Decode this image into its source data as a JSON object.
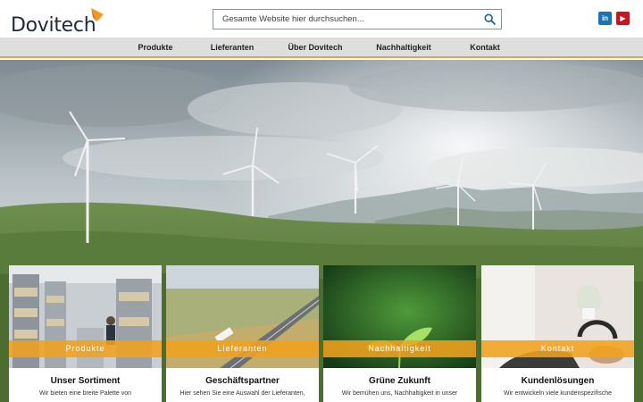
{
  "brand": {
    "name": "Dovitech",
    "accent": "#f0a23a"
  },
  "search": {
    "placeholder": "Gesamte Website hier durchsuchen..."
  },
  "social": {
    "linkedin": "in",
    "youtube": "▶"
  },
  "nav": {
    "items": [
      {
        "label": "Produkte"
      },
      {
        "label": "Lieferanten"
      },
      {
        "label": "Über Dovitech"
      },
      {
        "label": "Nachhaltigkeit"
      },
      {
        "label": "Kontakt"
      }
    ]
  },
  "cards": [
    {
      "band": "Produkte",
      "title": "Unser Sortiment",
      "text": "Wir bieten eine breite Palette von"
    },
    {
      "band": "Lieferanten",
      "title": "Geschäftspartner",
      "text": "Hier sehen Sie eine Auswahl der Lieferanten,"
    },
    {
      "band": "Nachhaltigkeit",
      "title": "Grüne Zukunft",
      "text": "Wir bemühen uns, Nachhaltigkeit in unser"
    },
    {
      "band": "Kontakt",
      "title": "Kundenlösungen",
      "text": "Wir entwickeln viele kundenspezifische"
    }
  ]
}
